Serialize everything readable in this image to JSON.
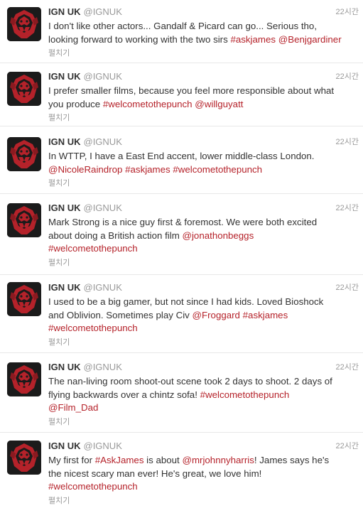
{
  "account": {
    "name": "IGN UK",
    "handle": "@IGNUK",
    "avatar_icon": "ign-logo-icon",
    "brand_color": "#b5222a"
  },
  "tweets": [
    {
      "time": "22시간",
      "expand_label": "펼치기",
      "lines": [
        [
          {
            "t": "I don't like other actors... Gandalf & Picard can go... Serious tho,"
          }
        ],
        [
          {
            "t": "looking forward to working with the two sirs "
          },
          {
            "t": "#askjames",
            "link": true
          },
          {
            "t": " "
          },
          {
            "t": "@Benjgardiner",
            "link": true
          }
        ]
      ]
    },
    {
      "time": "22시간",
      "expand_label": "펼치기",
      "lines": [
        [
          {
            "t": "I prefer smaller films, because you feel more responsible about what"
          }
        ],
        [
          {
            "t": "you produce "
          },
          {
            "t": "#welcometothepunch",
            "link": true
          },
          {
            "t": " "
          },
          {
            "t": "@willguyatt",
            "link": true
          }
        ]
      ]
    },
    {
      "time": "22시간",
      "expand_label": "펼치기",
      "lines": [
        [
          {
            "t": "In WTTP, I have a East End accent, lower middle-class London."
          }
        ],
        [
          {
            "t": "@NicoleRaindrop",
            "link": true
          },
          {
            "t": " "
          },
          {
            "t": "#askjames",
            "link": true
          },
          {
            "t": " "
          },
          {
            "t": "#welcometothepunch",
            "link": true
          }
        ]
      ]
    },
    {
      "time": "22시간",
      "expand_label": "펼치기",
      "lines": [
        [
          {
            "t": "Mark Strong is a nice guy first & foremost. We were both excited"
          }
        ],
        [
          {
            "t": "about doing a British action film "
          },
          {
            "t": "@jonathonbeggs",
            "link": true
          }
        ],
        [
          {
            "t": "#welcometothepunch",
            "link": true
          }
        ]
      ]
    },
    {
      "time": "22시간",
      "expand_label": "펼치기",
      "lines": [
        [
          {
            "t": "I used to be a big gamer, but not since I had kids. Loved Bioshock"
          }
        ],
        [
          {
            "t": "and Oblivion. Sometimes play Civ "
          },
          {
            "t": "@Froggard",
            "link": true
          },
          {
            "t": " "
          },
          {
            "t": "#askjames",
            "link": true
          }
        ],
        [
          {
            "t": "#welcometothepunch",
            "link": true
          }
        ]
      ]
    },
    {
      "time": "22시간",
      "expand_label": "펼치기",
      "lines": [
        [
          {
            "t": "The nan-living room shoot-out scene took 2 days to shoot. 2 days of"
          }
        ],
        [
          {
            "t": "flying backwards over a chintz sofa! "
          },
          {
            "t": "#welcometothepunch",
            "link": true
          }
        ],
        [
          {
            "t": "@Film_Dad",
            "link": true
          }
        ]
      ]
    },
    {
      "time": "22시간",
      "expand_label": "펼치기",
      "lines": [
        [
          {
            "t": "My first for "
          },
          {
            "t": "#AskJames",
            "link": true
          },
          {
            "t": " is about "
          },
          {
            "t": "@mrjohnnyharris",
            "link": true
          },
          {
            "t": "! James says he's"
          }
        ],
        [
          {
            "t": "the nicest scary man ever! He's great, we love him!"
          }
        ],
        [
          {
            "t": "#welcometothepunch",
            "link": true
          }
        ]
      ]
    }
  ]
}
